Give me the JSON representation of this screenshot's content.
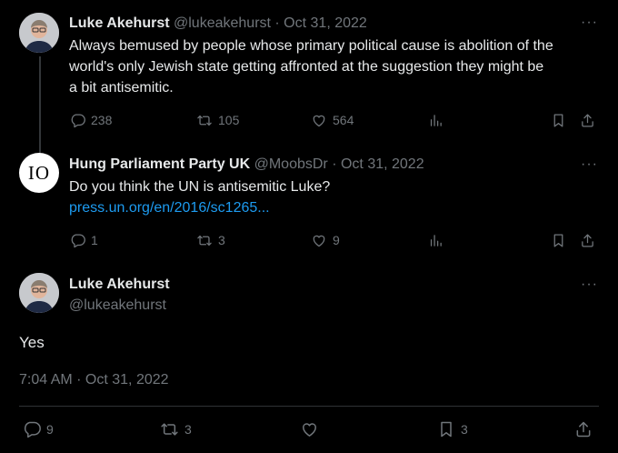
{
  "tweet1": {
    "name": "Luke Akehurst",
    "meta": "@lukeakehurst · Oct 31, 2022",
    "lines": [
      "Always bemused by people whose primary political cause is abolition of the",
      "world's only Jewish state getting affronted at the suggestion they might be",
      "a bit antisemitic."
    ],
    "replies": "238",
    "retweets": "105",
    "likes": "564"
  },
  "tweet2": {
    "name": "Hung Parliament Party UK",
    "meta": "@MoobsDr · Oct 31, 2022",
    "avatar_text": "IO",
    "text": "Do you think the UN is antisemitic Luke?",
    "link": "press.un.org/en/2016/sc1265...",
    "replies": "1",
    "retweets": "3",
    "likes": "9"
  },
  "main": {
    "name": "Luke Akehurst",
    "handle": "@lukeakehurst",
    "text": "Yes",
    "timestamp": "7:04 AM · Oct 31, 2022",
    "replies": "9",
    "retweets": "3",
    "bookmarks": "3"
  },
  "colors": {
    "background": "#000000",
    "text": "#e7e9ea",
    "muted": "#71767b",
    "link": "#1d9bf0"
  }
}
